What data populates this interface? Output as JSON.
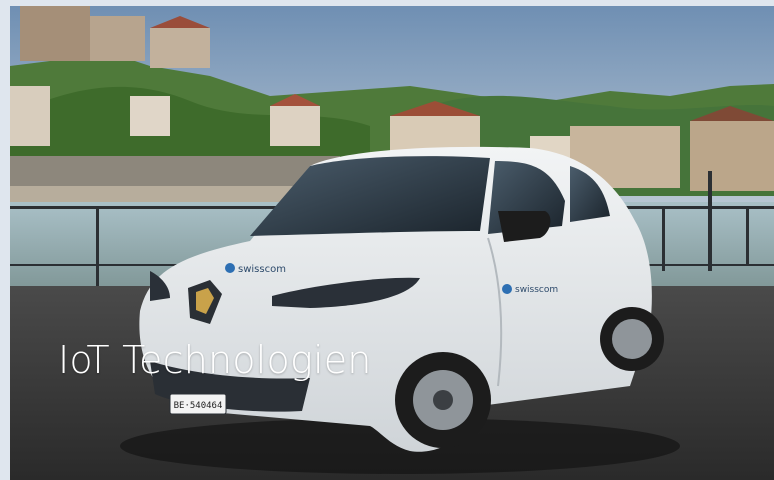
{
  "hero": {
    "title": "IoT Technologien",
    "car_brand_label": "swisscom",
    "license_plate": "BE·540464",
    "colors": {
      "sky": "#7f9fbf",
      "trees": "#3f6b2f",
      "water": "#9eb7bf",
      "road": "#3a3a3a",
      "car_body": "#e9ecee",
      "title_text": "#ffffff"
    }
  }
}
